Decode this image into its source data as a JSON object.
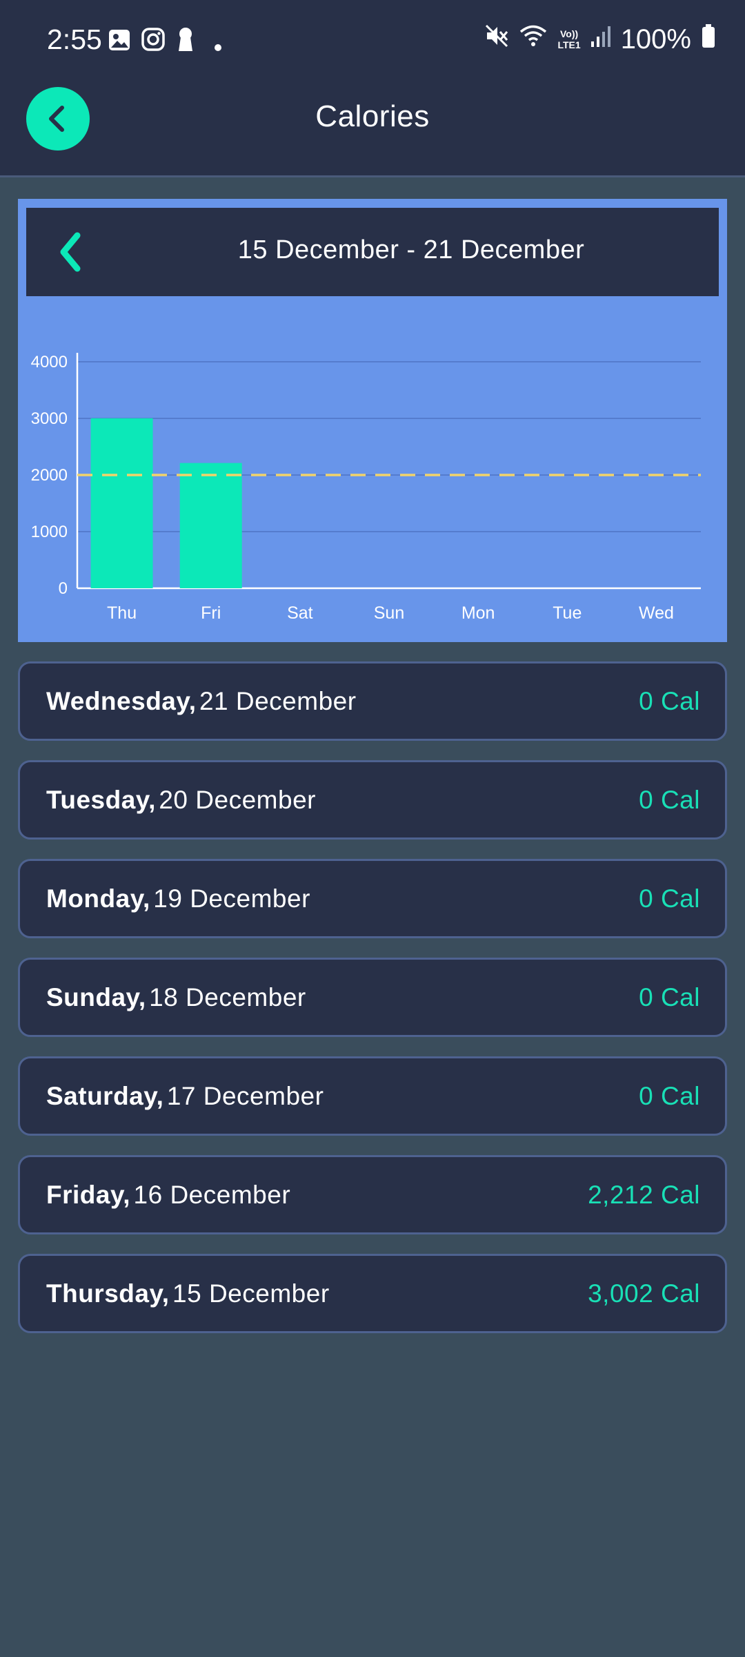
{
  "status_bar": {
    "time": "2:55",
    "battery": "100%",
    "network_label_1": "Vo))",
    "network_label_2": "LTE1",
    "notification_icons": [
      "image-icon",
      "instagram-icon",
      "keyhole-icon",
      "dot-icon"
    ],
    "system_icons": [
      "mute-icon",
      "wifi-icon",
      "signal-icon",
      "battery-icon"
    ]
  },
  "header": {
    "title": "Calories",
    "back_icon": "chevron-left-icon"
  },
  "week": {
    "range": "15 December - 21 December",
    "prev_icon": "chevron-left-icon"
  },
  "colors": {
    "accent": "#0ce8b8",
    "chart_bg": "#6895ea",
    "card_bg": "#283048",
    "goal_line": "#f1d36a"
  },
  "chart_data": {
    "type": "bar",
    "categories": [
      "Thu",
      "Fri",
      "Sat",
      "Sun",
      "Mon",
      "Tue",
      "Wed"
    ],
    "values": [
      3002,
      2212,
      0,
      0,
      0,
      0,
      0
    ],
    "goal": 2000,
    "yticks": [
      0,
      1000,
      2000,
      3000,
      4000
    ],
    "ylim": [
      0,
      4500
    ],
    "grid": true,
    "title": "",
    "xlabel": "",
    "ylabel": ""
  },
  "days": [
    {
      "name": "Wednesday,",
      "date": "21 December",
      "calories": "0 Cal"
    },
    {
      "name": "Tuesday,",
      "date": "20 December",
      "calories": "0 Cal"
    },
    {
      "name": "Monday,",
      "date": "19 December",
      "calories": "0 Cal"
    },
    {
      "name": "Sunday,",
      "date": "18 December",
      "calories": "0 Cal"
    },
    {
      "name": "Saturday,",
      "date": "17 December",
      "calories": "0 Cal"
    },
    {
      "name": "Friday,",
      "date": "16 December",
      "calories": "2,212 Cal"
    },
    {
      "name": "Thursday,",
      "date": "15 December",
      "calories": "3,002 Cal"
    }
  ]
}
